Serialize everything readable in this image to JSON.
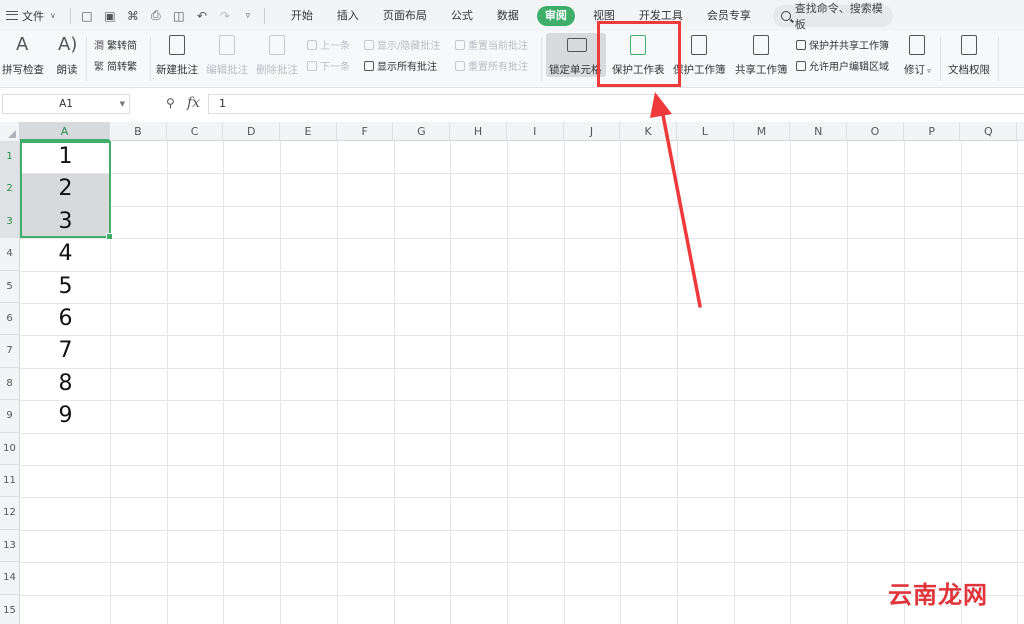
{
  "menubar": {
    "file_label": "文件",
    "tabs": [
      {
        "label": "开始",
        "active": false
      },
      {
        "label": "插入",
        "active": false
      },
      {
        "label": "页面布局",
        "active": false
      },
      {
        "label": "公式",
        "active": false
      },
      {
        "label": "数据",
        "active": false
      },
      {
        "label": "审阅",
        "active": true
      },
      {
        "label": "视图",
        "active": false
      },
      {
        "label": "开发工具",
        "active": false
      },
      {
        "label": "会员专享",
        "active": false
      }
    ],
    "search_placeholder": "查找命令、搜索模板"
  },
  "ribbon": {
    "spell_check": "拼写检查",
    "read_aloud": "朗读",
    "trad_to_simp": "繁转简",
    "simp_to_trad": "简转繁",
    "new_comment": "新建批注",
    "edit_comment": "编辑批注",
    "delete_comment": "删除批注",
    "prev": "上一条",
    "next": "下一条",
    "show_hide_comment": "显示/隐藏批注",
    "show_all_comments": "显示所有批注",
    "reset_current_comment": "重置当前批注",
    "reset_all_comments": "重置所有批注",
    "lock_cell": "锁定单元格",
    "protect_sheet": "保护工作表",
    "protect_workbook": "保护工作簿",
    "share_workbook": "共享工作簿",
    "protect_and_share": "保护并共享工作簿",
    "allow_edit_ranges": "允许用户编辑区域",
    "track_changes": "修订",
    "doc_permissions": "文档权限",
    "highlight_color": "#ee3a3a",
    "accent_color": "#3fae6b"
  },
  "formula_bar": {
    "name_box": "A1",
    "fx_label": "fx",
    "value": "1"
  },
  "sheet": {
    "columns": [
      "A",
      "B",
      "C",
      "D",
      "E",
      "F",
      "G",
      "H",
      "I",
      "J",
      "K",
      "L",
      "M",
      "N",
      "O",
      "P",
      "Q"
    ],
    "rows": [
      "1",
      "2",
      "3",
      "4",
      "5",
      "6",
      "7",
      "8",
      "9",
      "10",
      "11",
      "12",
      "13",
      "14",
      "15"
    ],
    "column_a_values": [
      "1",
      "2",
      "3",
      "4",
      "5",
      "6",
      "7",
      "8",
      "9"
    ],
    "selected_range": "A1:A3"
  },
  "watermark": "云南龙网"
}
